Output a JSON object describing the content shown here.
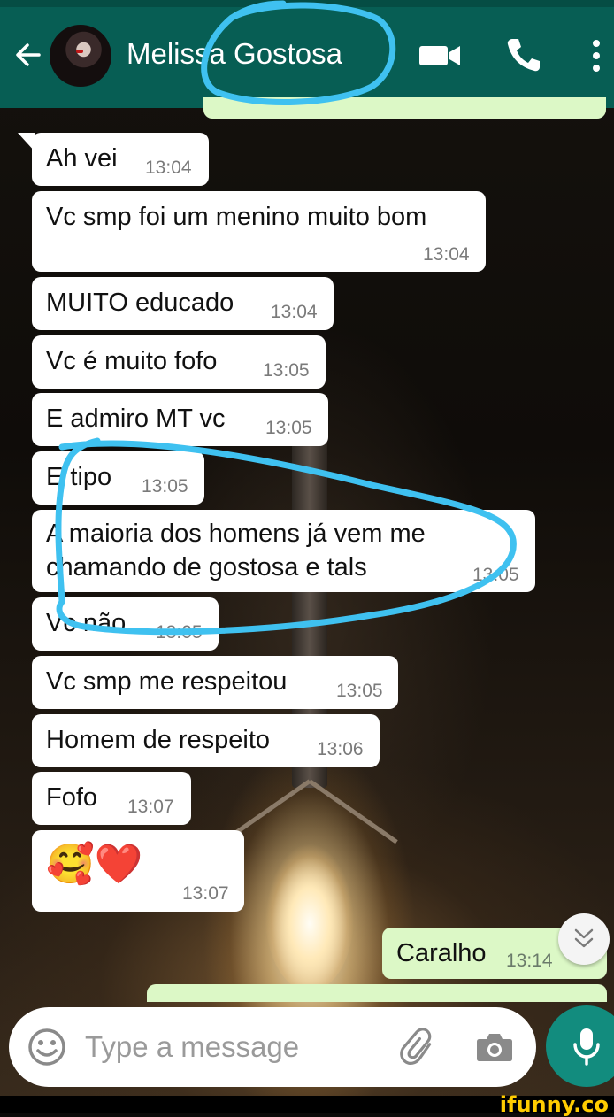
{
  "header": {
    "contact_name": "Melissa Gostosa",
    "icons": [
      "back-arrow-icon",
      "avatar",
      "video-call-icon",
      "phone-icon",
      "more-vert-icon"
    ]
  },
  "messages": [
    {
      "text": "Ah vei",
      "time": "13:04"
    },
    {
      "text": "Vc smp foi um menino muito bom",
      "time": "13:04"
    },
    {
      "text": "MUITO educado",
      "time": "13:04"
    },
    {
      "text": "Vc é muito fofo",
      "time": "13:05"
    },
    {
      "text": "E admiro MT vc",
      "time": "13:05"
    },
    {
      "text": "E tipo",
      "time": "13:05"
    },
    {
      "text": "A maioria dos homens já vem me",
      "text2": "chamando de gostosa e tals",
      "time": "13:05"
    },
    {
      "text": "Vc não",
      "time": "13:05"
    },
    {
      "text": "Vc smp me respeitou",
      "time": "13:05"
    },
    {
      "text": "Homem de respeito",
      "time": "13:06"
    },
    {
      "text": "Fofo",
      "time": "13:07"
    },
    {
      "text": "🥰❤️",
      "time": "13:07"
    }
  ],
  "outgoing": {
    "text": "Caralho",
    "time": "13:14"
  },
  "composer": {
    "placeholder": "Type a message"
  },
  "watermark": "ifunny.co",
  "colors": {
    "header": "#075e54",
    "outgoing_bubble": "#dcf8c6",
    "mic_button": "#128c7e",
    "annotation": "#3fc1f0"
  }
}
